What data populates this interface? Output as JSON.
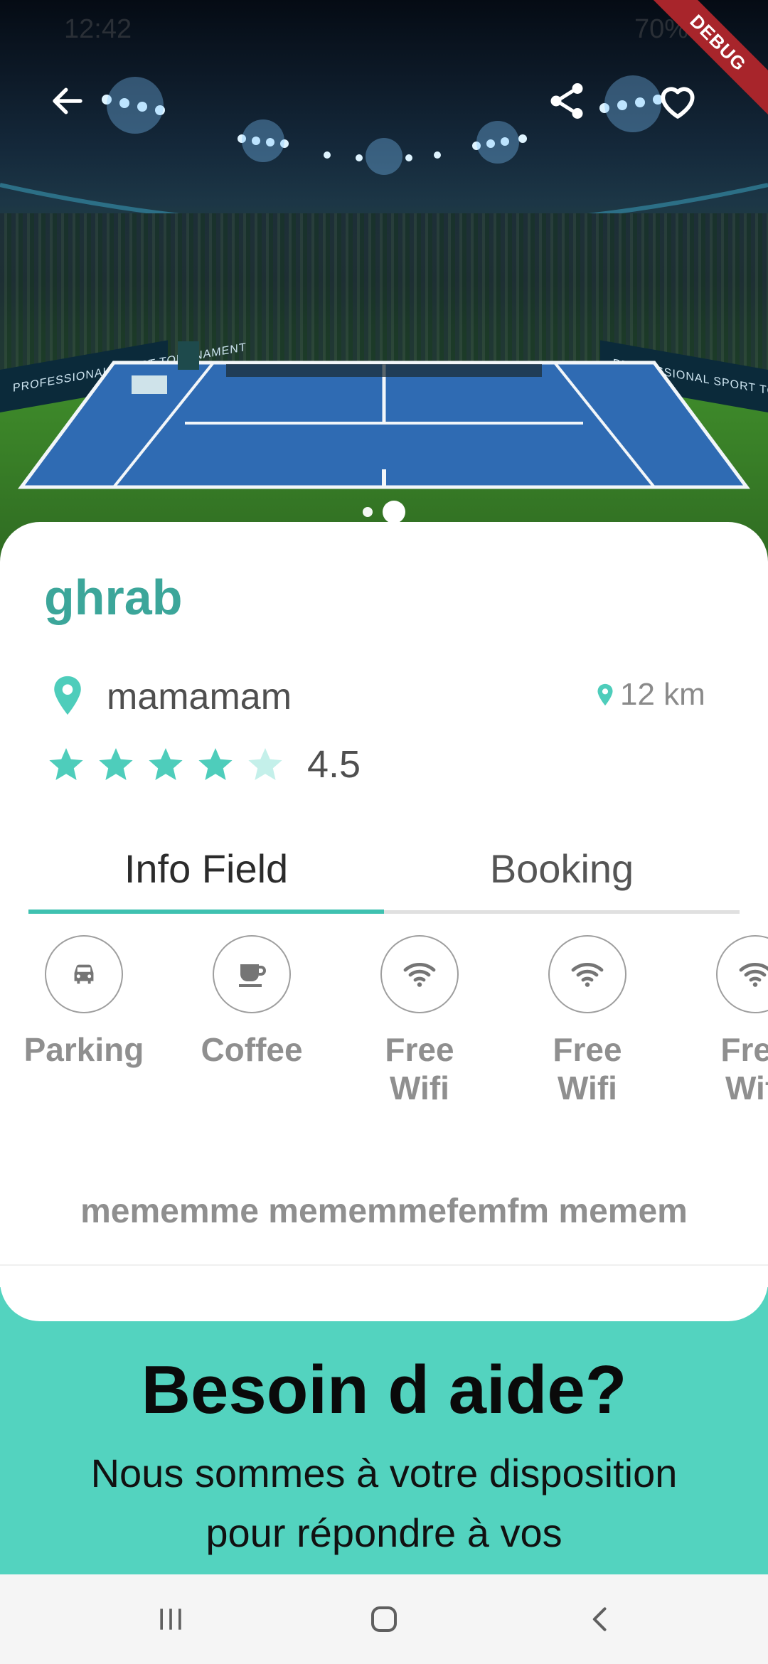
{
  "status_bar": {
    "time": "12:42",
    "battery": "70%"
  },
  "debug_ribbon": "DEBUG",
  "hero": {
    "banner_left": "PROFESSIONAL SPORT TOURNAMENT",
    "banner_right": "PROFESSIONAL SPORT TOURNAMENT",
    "carousel": {
      "count": 2,
      "active": 2
    }
  },
  "venue": {
    "name": "ghrab",
    "city": "mamamam",
    "distance": "12 km",
    "rating": "4.5",
    "stars_filled": 4.5
  },
  "tabs": [
    {
      "label": "Info Field",
      "active": true
    },
    {
      "label": "Booking",
      "active": false
    }
  ],
  "amenities": [
    {
      "label": "Parking",
      "icon": "car-icon"
    },
    {
      "label": "Coffee",
      "icon": "coffee-icon"
    },
    {
      "label": "Free\nWifi",
      "icon": "wifi-icon"
    },
    {
      "label": "Free\nWifi",
      "icon": "wifi-icon"
    },
    {
      "label": "Free\nWifi",
      "icon": "wifi-icon"
    }
  ],
  "description": "mememme mememmefemfm memem",
  "help": {
    "title": "Besoin d aide?",
    "text": "Nous sommes à votre disposition pour répondre à vos"
  },
  "colors": {
    "accent": "#3fc1b0",
    "name": "#3ca69a",
    "help_bg": "#53d3bf"
  }
}
